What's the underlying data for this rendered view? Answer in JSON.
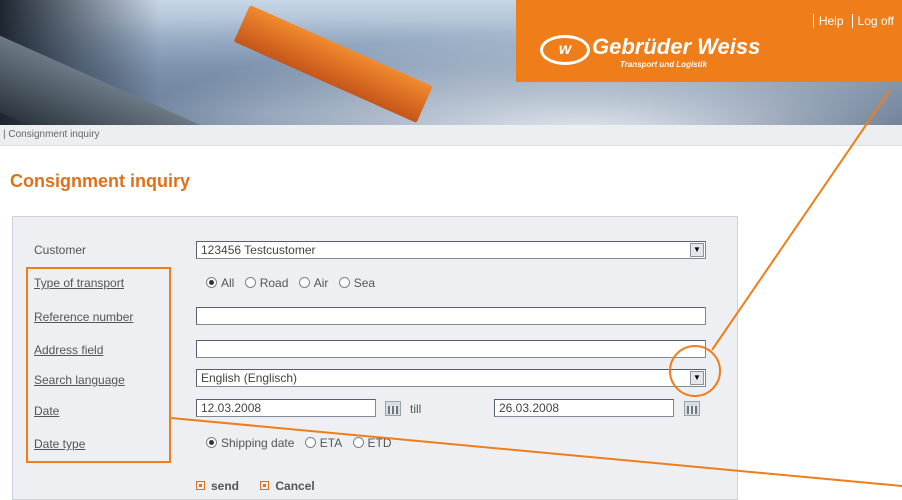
{
  "header": {
    "brand_name": "Gebrüder Weiss",
    "brand_tagline": "Transport und Logistik",
    "logo_mark": "w",
    "links": [
      "Help",
      "Log off"
    ]
  },
  "breadcrumb": "| Consignment inquiry",
  "page_title": "Consignment inquiry",
  "form": {
    "customer": {
      "label": "Customer",
      "value": "123456  Testcustomer"
    },
    "type_of_transport": {
      "label": "Type of transport",
      "options": [
        "All",
        "Road",
        "Air",
        "Sea"
      ],
      "selected": "All"
    },
    "reference_number": {
      "label": "Reference number",
      "value": ""
    },
    "address_field": {
      "label": "Address field",
      "value": ""
    },
    "search_language": {
      "label": "Search language",
      "value": "English (Englisch)"
    },
    "date": {
      "label": "Date",
      "from": "12.03.2008",
      "till_label": "till",
      "to": "26.03.2008"
    },
    "date_type": {
      "label": "Date type",
      "options": [
        "Shipping date",
        "ETA",
        "ETD"
      ],
      "selected": "Shipping date"
    }
  },
  "actions": {
    "send": "send",
    "cancel": "Cancel"
  },
  "colors": {
    "accent": "#ef7d1a",
    "title": "#e0701a",
    "panel": "#edeff2"
  },
  "icons": [
    "dropdown-arrow-icon",
    "calendar-icon",
    "bullet-icon"
  ]
}
